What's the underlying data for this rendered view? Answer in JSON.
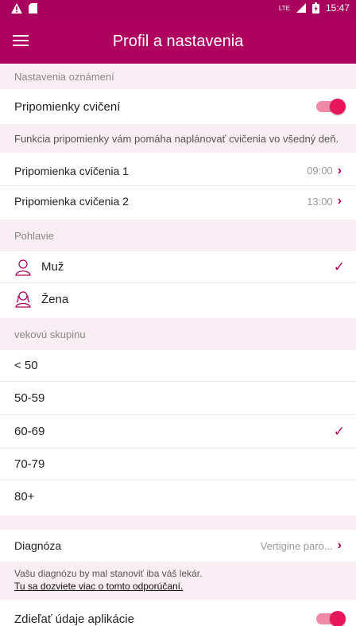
{
  "status_bar": {
    "time": "15:47",
    "network": "LTE"
  },
  "app_bar": {
    "title": "Profil a nastavenia"
  },
  "notifications": {
    "section_label": "Nastavenia oznámení",
    "toggle_label": "Pripomienky cvičení",
    "toggle_on": true,
    "info": "Funkcia pripomienky vám pomáha naplánovať cvičenia vo všedný deň.",
    "reminders": [
      {
        "label": "Pripomienka cvičenia 1",
        "time": "09:00"
      },
      {
        "label": "Pripomienka cvičenia 2",
        "time": "13:00"
      }
    ]
  },
  "gender": {
    "section_label": "Pohlavie",
    "options": [
      {
        "label": "Muž",
        "selected": true
      },
      {
        "label": "Žena",
        "selected": false
      }
    ]
  },
  "age_group": {
    "section_label": "vekovú skupinu",
    "options": [
      {
        "label": "< 50",
        "selected": false
      },
      {
        "label": "50-59",
        "selected": false
      },
      {
        "label": "60-69",
        "selected": true
      },
      {
        "label": "70-79",
        "selected": false
      },
      {
        "label": "80+",
        "selected": false
      }
    ]
  },
  "diagnosis": {
    "label": "Diagnóza",
    "value": "Vertigine paro...",
    "note": "Vašu diagnózu by mal stanoviť iba váš lekár.",
    "link": "Tu sa dozviete viac o tomto odporúčaní."
  },
  "share": {
    "label": "Zdieľať údaje aplikácie",
    "toggle_on": true
  },
  "colors": {
    "primary": "#b0005f",
    "accent": "#e8165a",
    "section_bg": "#f8eef3"
  },
  "glyphs": {
    "chevron": "›",
    "check": "✓"
  }
}
